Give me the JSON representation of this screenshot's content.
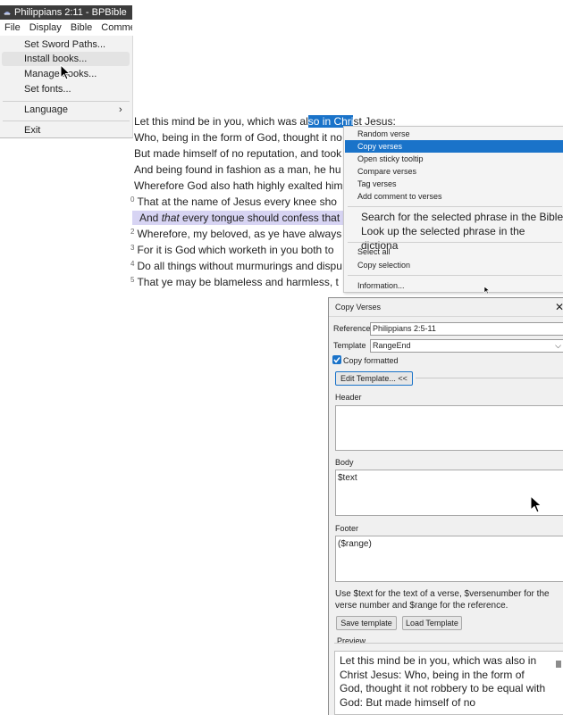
{
  "window": {
    "title": "Philippians 2:11 - BPBible"
  },
  "menubar": [
    "File",
    "Display",
    "Bible",
    "Comment"
  ],
  "file_menu": {
    "items": [
      "Set Sword Paths...",
      "Install books...",
      "Manage books...",
      "Set fonts...",
      "Language",
      "Exit"
    ],
    "highlighted": "Install books..."
  },
  "bible_text": {
    "v5_pre": "Let this mind be in you, which was al",
    "v5_sel": "so in Chri",
    "v5_post": "st Jesus:",
    "v6": "Who, being in the form of God, thought it no",
    "v7": "But made himself of no reputation, and took",
    "v8": "And being found in fashion as a man, he hu",
    "v9": "Wherefore God also hath highly exalted him",
    "v10_num": "0",
    "v10": "That at the name of Jesus every knee sho",
    "v11_a": "And ",
    "v11_b": "that",
    "v11_c": " every tongue should confess that",
    "v12_num": "2",
    "v12": "Wherefore, my beloved, as ye have always",
    "v13_num": "3",
    "v13": "For it is God which worketh in you both to",
    "v14_num": "4",
    "v14": "Do all things without murmurings and dispu",
    "v15_num": "5",
    "v15": "That ye may be blameless and harmless, t"
  },
  "context_menu": {
    "random_verse": "Random verse",
    "copy_verses": "Copy verses",
    "open_sticky": "Open sticky tooltip",
    "compare": "Compare verses",
    "tag": "Tag verses",
    "add_comment": "Add comment to verses",
    "search_phrase": "Search for the selected phrase in the Bible",
    "lookup_phrase": "Look up the selected phrase in the dictiona",
    "select_all": "Select all",
    "copy_selection": "Copy selection",
    "information": "Information..."
  },
  "dialog": {
    "title": "Copy Verses",
    "reference_label": "Reference",
    "reference_value": "Philippians 2:5-11",
    "template_label": "Template",
    "template_value": "RangeEnd",
    "copy_formatted_label": "Copy formatted",
    "copy_formatted_checked": true,
    "edit_template_button": "Edit Template... <<",
    "header_label": "Header",
    "header_value": "",
    "body_label": "Body",
    "body_value": "$text",
    "footer_label": "Footer",
    "footer_value": "($range)",
    "help_text_1": "Use $text for the text of a verse, $versenumber for the",
    "help_text_2": "verse number and $range for the reference.",
    "save_template_button": "Save template",
    "load_template_button": "Load Template",
    "preview_label": "Preview",
    "preview_text": "Let this mind be in you, which was also in Christ Jesus: Who, being in the form of God, thought it not robbery to be equal with God: But made himself of no"
  },
  "colors": {
    "selection": "#1a73c9",
    "verse_highlight": "#d7d4f3",
    "titlebar": "#3c3c3c"
  }
}
